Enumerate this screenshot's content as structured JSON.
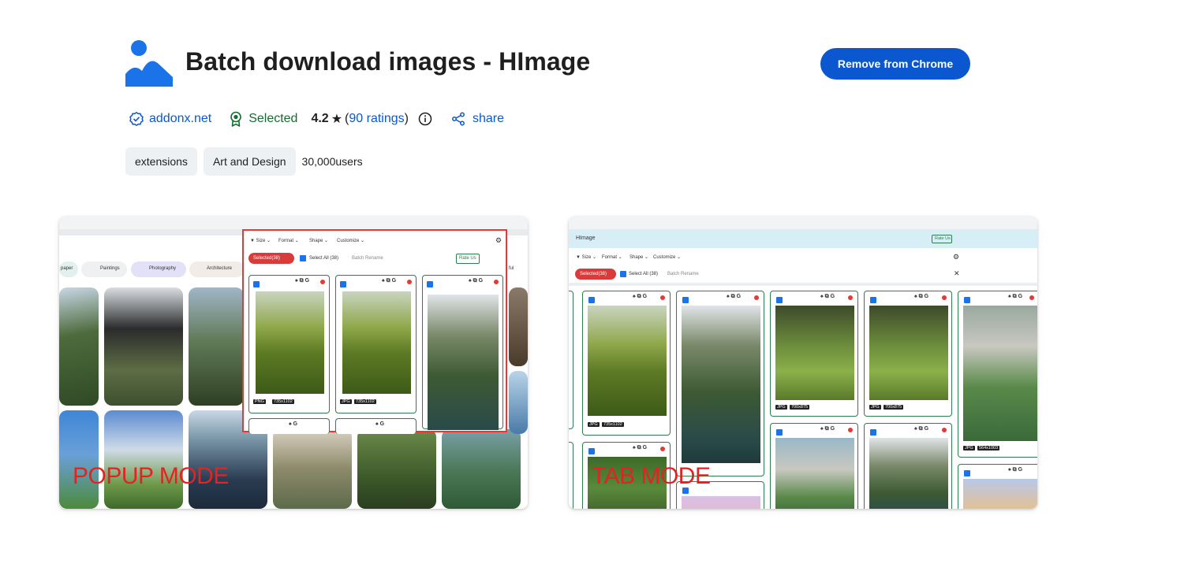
{
  "extension": {
    "title": "Batch download images - HImage",
    "remove_label": "Remove from Chrome"
  },
  "meta": {
    "publisher": "addonx.net",
    "badge": "Selected",
    "rating_value": "4.2",
    "rating_open": "(",
    "ratings_count": "90 ratings",
    "rating_close": ")",
    "share": "share"
  },
  "chips": {
    "category": "extensions",
    "subcategory": "Art and Design",
    "users": "30,000users"
  },
  "screenshots": [
    {
      "label": "POPUP MODE",
      "toolbar": [
        "Size",
        "Format",
        "Shape",
        "Customize"
      ],
      "selected": "Selected(38)",
      "select_all": "Select All (38)",
      "batch_rename": "Batch Rename",
      "rate_us": "Rate Us",
      "categories": [
        "paper",
        "Paintings",
        "Photography",
        "Architecture",
        "ful"
      ],
      "badges": [
        [
          "PNG",
          "735x1102"
        ],
        [
          "JPG",
          "735x1102"
        ]
      ]
    },
    {
      "label": "TAB MODE",
      "app_name": "HImage",
      "toolbar": [
        "Size",
        "Format",
        "Shape",
        "Customize"
      ],
      "selected": "Selected(38)",
      "select_all": "Select All (38)",
      "batch_rename": "Batch Rename",
      "rate_us": "Rate Us",
      "badges": [
        [
          "JPG",
          "735x1102"
        ],
        [
          "JPG",
          "700x875"
        ],
        [
          "JPG",
          "700x875"
        ],
        [
          "JPG",
          "564x1003"
        ]
      ]
    }
  ],
  "colors": {
    "accent": "#0b57d0",
    "badge_green": "#146c2e",
    "mode_label": "#e02424",
    "selected_pill": "#d93a3a"
  },
  "icons": [
    "himage-logo-icon",
    "verified-icon",
    "featured-badge-icon",
    "star-icon",
    "info-icon",
    "share-icon"
  ]
}
